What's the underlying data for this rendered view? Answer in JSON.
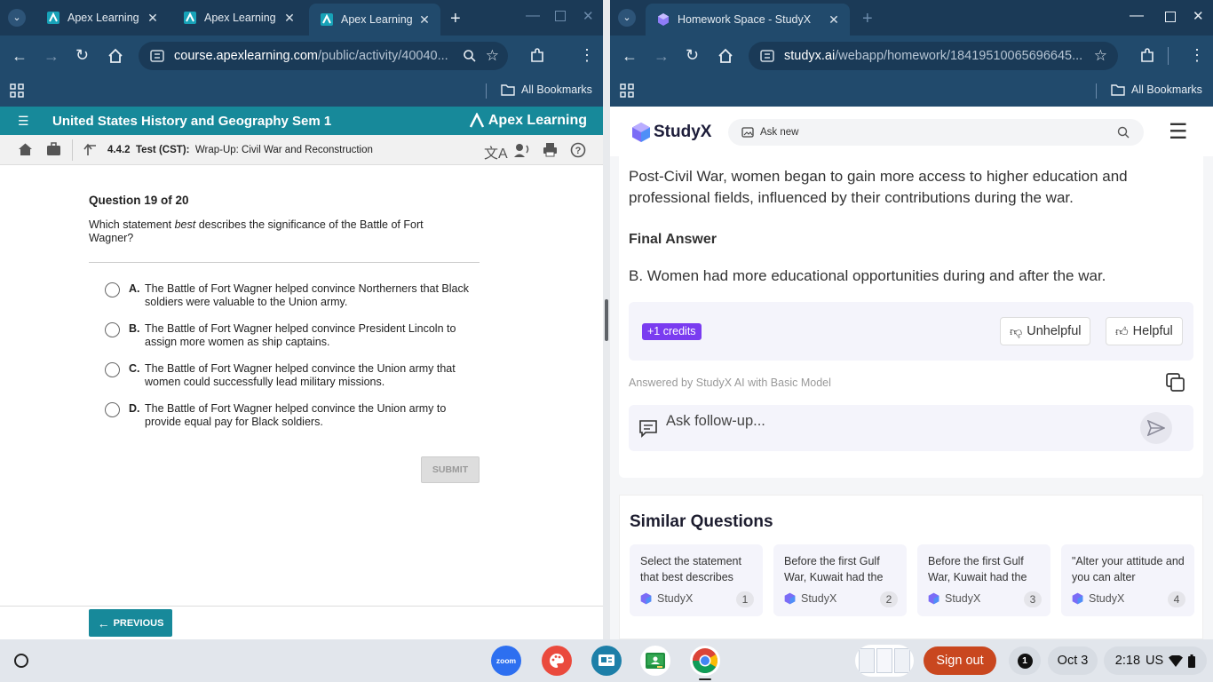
{
  "left_browser": {
    "tabs": [
      {
        "title": "Apex Learning"
      },
      {
        "title": "Apex Learning"
      },
      {
        "title": "Apex Learning"
      }
    ],
    "url_host": "course.apexlearning.com",
    "url_path": "/public/activity/40040...",
    "bookmarks_label": "All Bookmarks"
  },
  "apex": {
    "course_title": "United States History and Geography Sem 1",
    "brand": "Apex Learning",
    "activity_code": "4.4.2",
    "activity_type": "Test (CST):",
    "activity_title": "Wrap-Up: Civil War and Reconstruction",
    "question_number": "Question 19 of 20",
    "question_pre": "Which statement ",
    "question_emph": "best",
    "question_post": " describes the significance of the Battle of Fort Wagner?",
    "options": [
      {
        "letter": "A.",
        "text": "The Battle of Fort Wagner helped convince Northerners that Black soldiers were valuable to the Union army."
      },
      {
        "letter": "B.",
        "text": "The Battle of Fort Wagner helped convince President Lincoln to assign more women as ship captains."
      },
      {
        "letter": "C.",
        "text": "The Battle of Fort Wagner helped convince the Union army that women could successfully lead military missions."
      },
      {
        "letter": "D.",
        "text": "The Battle of Fort Wagner helped convince the Union army to provide equal pay for Black soldiers."
      }
    ],
    "submit_label": "SUBMIT",
    "previous_label": "PREVIOUS"
  },
  "right_browser": {
    "tab_title": "Homework Space - StudyX",
    "url_host": "studyx.ai",
    "url_path": "/webapp/homework/18419510065696645...",
    "bookmarks_label": "All Bookmarks"
  },
  "studyx": {
    "logo_text": "StudyX",
    "search_label": "Ask new",
    "answer_paragraph": "Post-Civil War, women began to gain more access to higher education and professional fields, influenced by their contributions during the war.",
    "final_heading": "Final Answer",
    "final_answer": "B. Women had more educational opportunities during and after the war.",
    "credits_label": "+1 credits",
    "unhelpful_label": "Unhelpful",
    "helpful_label": "Helpful",
    "answered_by": "Answered by StudyX AI with Basic Model",
    "followup_placeholder": "Ask follow-up...",
    "similar_title": "Similar Questions",
    "similar": [
      {
        "text": "Select the statement that best describes",
        "brand": "StudyX",
        "num": "1"
      },
      {
        "text": "Before the first Gulf War, Kuwait had the",
        "brand": "StudyX",
        "num": "2"
      },
      {
        "text": "Before the first Gulf War, Kuwait had the",
        "brand": "StudyX",
        "num": "3"
      },
      {
        "text": "\"Alter your attitude and you can alter",
        "brand": "StudyX",
        "num": "4"
      }
    ]
  },
  "shelf": {
    "zoom_label": "zoom",
    "sign_out_label": "Sign out",
    "notification_count": "1",
    "date": "Oct 3",
    "time": "2:18",
    "locale": "US"
  },
  "colors": {
    "chrome_tabstrip": "#1b3a57",
    "chrome_toolbar": "#214a6c",
    "apex_teal": "#17899a",
    "studyx_purple": "#7a3cf0",
    "sign_out": "#c9471f"
  }
}
